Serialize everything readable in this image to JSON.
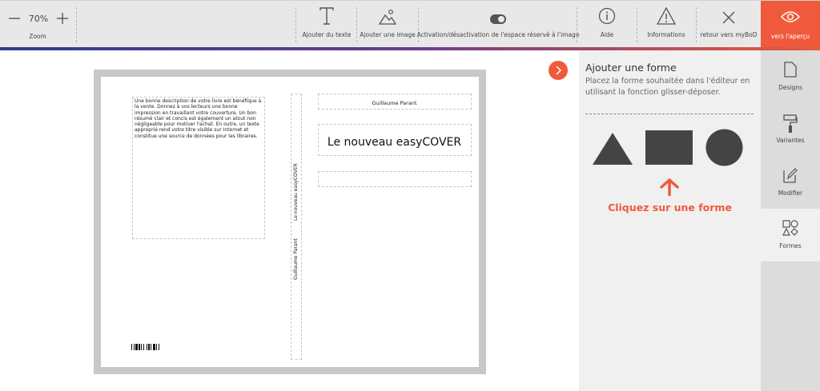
{
  "toolbar": {
    "zoom": {
      "value": "70%",
      "label": "Zoom"
    },
    "add_text": "Ajouter du texte",
    "add_image": "Ajouter une image",
    "toggle_placeholder": "Activation/désactivation de l'espace réservé à l'image",
    "help": "Aide",
    "info": "Informations",
    "back": "retour vers myBoD",
    "preview": "vers l'aperçu"
  },
  "book": {
    "back_description": "Une bonne description de votre livre est bénéfique à la vente.  Donnez à vos lecteurs une bonne impression en travaillant votre couverture. Un bon résumé clair et concis est également un atout non négligeable pour motiver l'achat. En outre, un texte approprié rend votre titre visible sur Internet et constitue une source de données pour les libraires.",
    "spine_title": "Le nouveau easyCOVER",
    "spine_author": "Guillaume Parant",
    "front_author": "Guillaume Parant",
    "front_title": "Le nouveau easyCOVER"
  },
  "panel": {
    "title": "Ajouter une forme",
    "description": "Placez la forme souhaitée dans l'éditeur en utilisant la fonction glisser-déposer.",
    "shapes": [
      "triangle",
      "rectangle",
      "circle"
    ],
    "hint": "Cliquez sur une forme"
  },
  "sidebar": {
    "tabs": [
      {
        "label": "Designs",
        "icon": "document-icon"
      },
      {
        "label": "Variantes",
        "icon": "paint-roller-icon"
      },
      {
        "label": "Modifier",
        "icon": "edit-icon"
      },
      {
        "label": "Formes",
        "icon": "shapes-icon"
      }
    ],
    "active": "Formes"
  },
  "colors": {
    "accent": "#f05a3c",
    "toolbar_bg": "#e8e8e8",
    "panel_bg": "#f0f0f0",
    "sidebar_bg": "#dcdcdc",
    "shape_fill": "#444444"
  }
}
